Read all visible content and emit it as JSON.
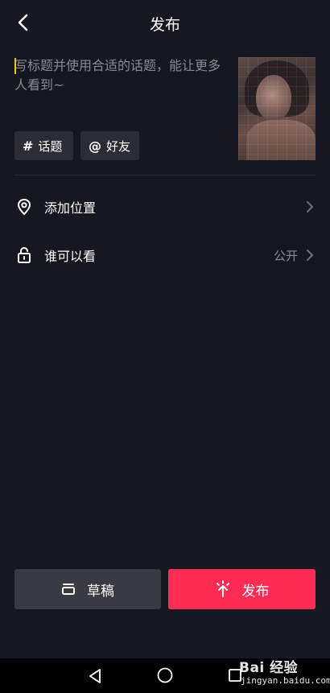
{
  "header": {
    "title": "发布",
    "back_icon": "chevron-left-icon"
  },
  "caption": {
    "placeholder": "写标题并使用合适的话题，能让更多人看到~",
    "value": ""
  },
  "chips": [
    {
      "glyph": "#",
      "label": "话题",
      "icon": "hashtag-icon"
    },
    {
      "glyph": "@",
      "label": "好友",
      "icon": "at-icon"
    }
  ],
  "rows": {
    "location": {
      "label": "添加位置",
      "icon": "location-pin-icon"
    },
    "privacy": {
      "label": "谁可以看",
      "value": "公开",
      "icon": "unlock-icon"
    }
  },
  "buttons": {
    "draft": {
      "label": "草稿",
      "icon": "draft-box-icon"
    },
    "publish": {
      "label": "发布",
      "icon": "publish-sparkle-icon"
    }
  },
  "colors": {
    "background": "#171722",
    "chip": "#2c2c37",
    "draft_button": "#3a3a45",
    "publish_button": "#fe2c55",
    "secondary_text": "#8a8a93",
    "caret": "#f5c518"
  },
  "watermark": {
    "logo": "Bai 经验",
    "url": "jingyan.baidu.com"
  }
}
